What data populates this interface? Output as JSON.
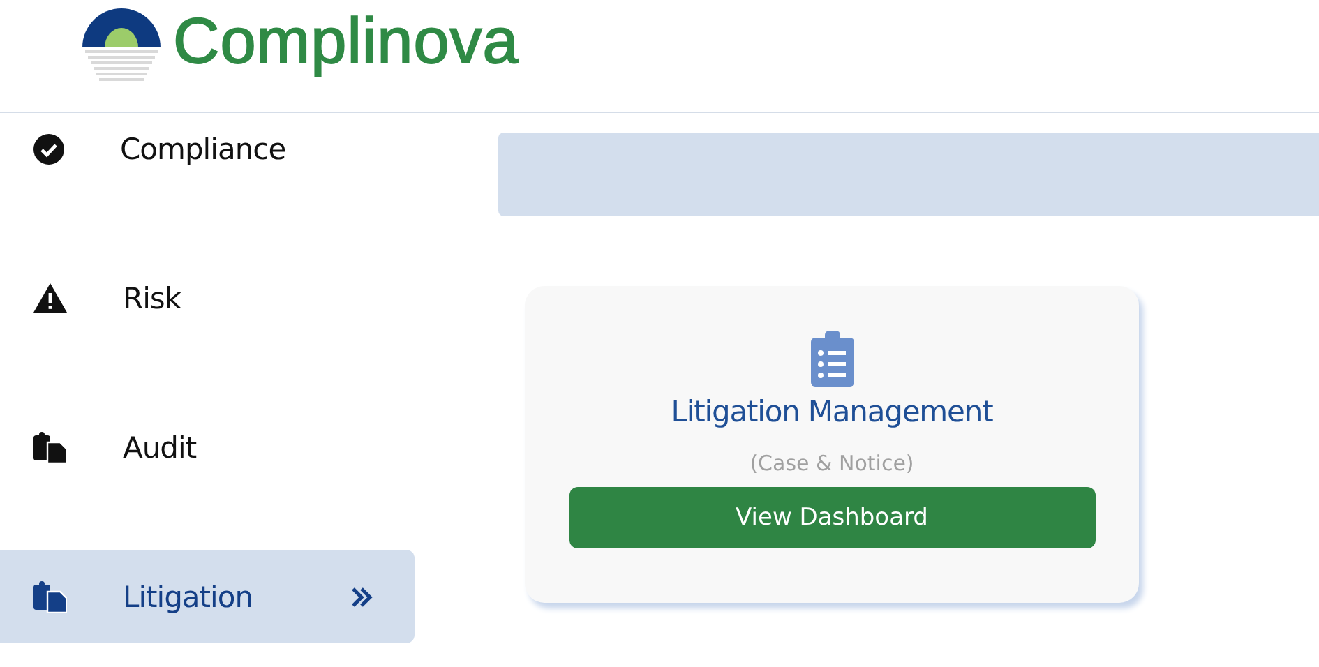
{
  "header": {
    "brand": "Complinova"
  },
  "sidebar": {
    "items": [
      {
        "label": "Compliance",
        "selected": false
      },
      {
        "label": "Risk",
        "selected": false
      },
      {
        "label": "Audit",
        "selected": false
      },
      {
        "label": "Litigation",
        "selected": true
      }
    ]
  },
  "cards": [
    {
      "title": "Litigation Management",
      "subtitle": "(Case & Notice)",
      "button": "View Dashboard"
    }
  ]
}
